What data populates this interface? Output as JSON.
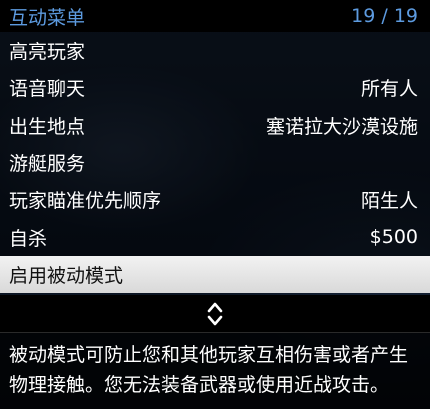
{
  "header": {
    "title": "互动菜单",
    "counter": "19 / 19"
  },
  "items": [
    {
      "label": "高亮玩家",
      "value": ""
    },
    {
      "label": "语音聊天",
      "value": "所有人"
    },
    {
      "label": "出生地点",
      "value": "塞诺拉大沙漠设施"
    },
    {
      "label": "游艇服务",
      "value": ""
    },
    {
      "label": "玩家瞄准优先顺序",
      "value": "陌生人"
    },
    {
      "label": "自杀",
      "value": "$500"
    },
    {
      "label": "启用被动模式",
      "value": ""
    }
  ],
  "selected_item": "启用被动模式",
  "scroll_icon": "up-down-chevron-icon",
  "description": "被动模式可防止您和其他玩家互相伤害或者产生物理接触。您无法装备武器或使用近战攻击。",
  "colors": {
    "header_text": "#5d9be0",
    "selected_bg": "#e6e6e6",
    "item_text": "#ffffff"
  }
}
